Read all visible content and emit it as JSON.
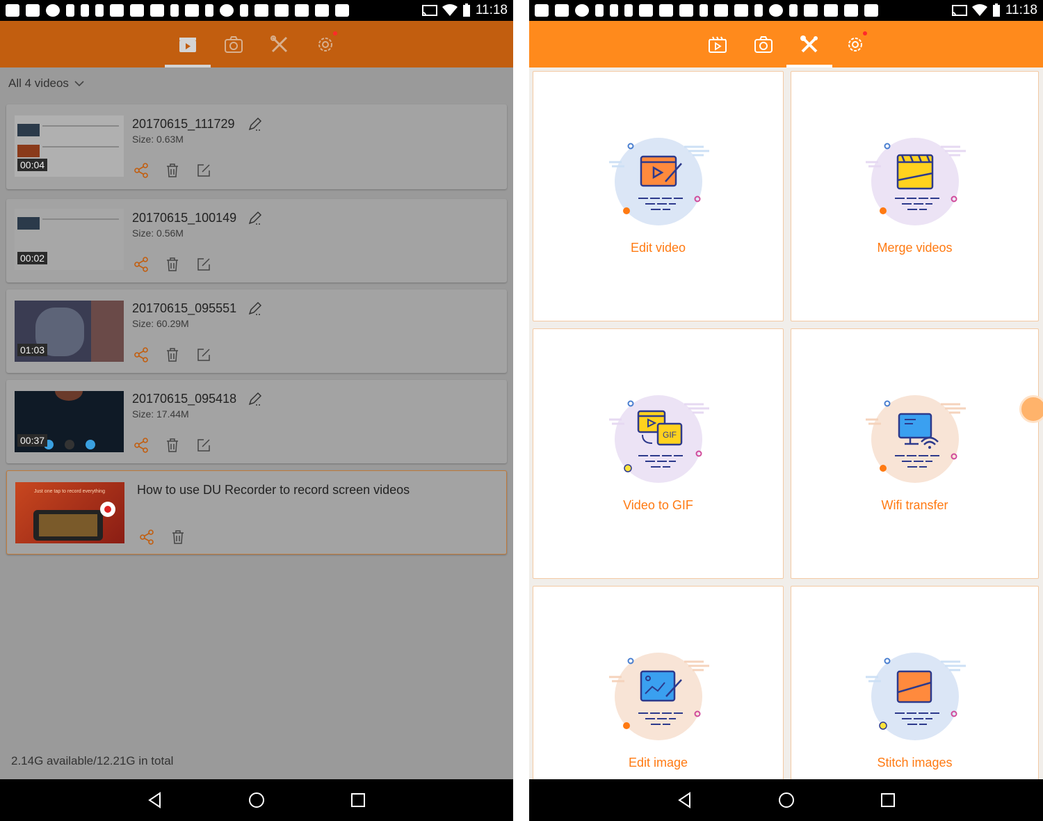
{
  "status_bar": {
    "time": "11:18"
  },
  "colors": {
    "accent": "#ff8a1c",
    "accent_dark": "#c25e0f",
    "label_orange": "#ff7a12"
  },
  "tabs": [
    {
      "name": "videos",
      "icon": "video-clapper-icon"
    },
    {
      "name": "screenshots",
      "icon": "camera-icon"
    },
    {
      "name": "tools",
      "icon": "tools-icon"
    },
    {
      "name": "settings",
      "icon": "gear-icon",
      "has_badge": true
    }
  ],
  "left_screen": {
    "active_tab": "videos",
    "filter_label": "All 4 videos",
    "videos": [
      {
        "title": "20170615_111729",
        "size": "Size: 0.63M",
        "duration": "00:04"
      },
      {
        "title": "20170615_100149",
        "size": "Size: 0.56M",
        "duration": "00:02"
      },
      {
        "title": "20170615_095551",
        "size": "Size: 60.29M",
        "duration": "01:03"
      },
      {
        "title": "20170615_095418",
        "size": "Size: 17.44M",
        "duration": "00:37"
      }
    ],
    "promo": {
      "title": "How to use DU Recorder to record screen videos",
      "thumb_caption": "Just one tap to record everything"
    },
    "storage": "2.14G available/12.21G in total"
  },
  "right_screen": {
    "active_tab": "tools",
    "tools": [
      {
        "label": "Edit video",
        "icon": "edit-video-icon"
      },
      {
        "label": "Merge videos",
        "icon": "merge-videos-icon"
      },
      {
        "label": "Video to GIF",
        "icon": "video-to-gif-icon",
        "badge": "GIF"
      },
      {
        "label": "Wifi transfer",
        "icon": "wifi-transfer-icon"
      },
      {
        "label": "Edit image",
        "icon": "edit-image-icon"
      },
      {
        "label": "Stitch images",
        "icon": "stitch-images-icon"
      }
    ]
  }
}
